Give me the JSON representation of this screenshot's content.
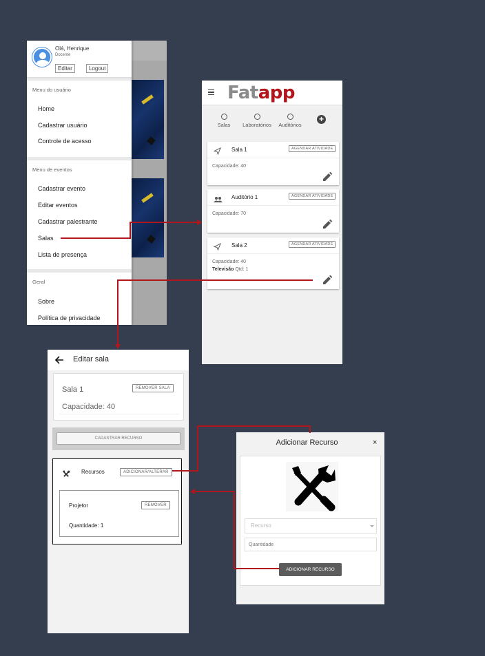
{
  "drawer": {
    "greeting": "Olá, Henrique",
    "role": "Docente",
    "edit_label": "Editar",
    "logout_label": "Logout",
    "user_section": "Menu do usuário",
    "user_items": [
      "Home",
      "Cadastrar usuário",
      "Controle de acesso"
    ],
    "events_section": "Menu de eventos",
    "event_items": [
      "Cadastrar evento",
      "Editar eventos",
      "Cadastrar palestrante",
      "Salas",
      "Lista de presença"
    ],
    "general_section": "Geral",
    "general_items": [
      "Sobre",
      "Política de privacidade"
    ]
  },
  "rooms": {
    "logo_part1": "Fat",
    "logo_part2": "app",
    "filters": [
      "Salas",
      "Laboratórios",
      "Auditórios"
    ],
    "schedule_label": "AGENDAR ATIVIDADE",
    "cards": [
      {
        "name": "Sala 1",
        "capacity": "Capacidade: 40",
        "icon": "send-icon"
      },
      {
        "name": "Auditório 1",
        "capacity": "Capacidade: 70",
        "icon": "people-icon"
      },
      {
        "name": "Sala 2",
        "capacity": "Capacidade: 40",
        "icon": "send-icon",
        "resource_name": "Televisão",
        "resource_qty": "Qtd: 1"
      }
    ]
  },
  "edit_room": {
    "title": "Editar sala",
    "room_name": "Sala 1",
    "remove_room_label": "REMOVER SALA",
    "capacity": "Capacidade: 40",
    "register_resource_label": "CADASTRAR RECURSO",
    "resources_label": "Recursos",
    "add_alter_label": "ADICIONAR/ALTERAR",
    "resource": {
      "name": "Projetor",
      "remove_label": "REMOVER",
      "quantity": "Quantidade: 1"
    }
  },
  "add_resource": {
    "title": "Adicionar Recurso",
    "close_glyph": "×",
    "resource_placeholder": "Recurso",
    "quantity_placeholder": "Quantidade",
    "submit_label": "ADICIONAR RECURSO"
  },
  "colors": {
    "background": "#343e4f",
    "accent": "#b0161b",
    "logo_gray": "#8a8a8a"
  }
}
